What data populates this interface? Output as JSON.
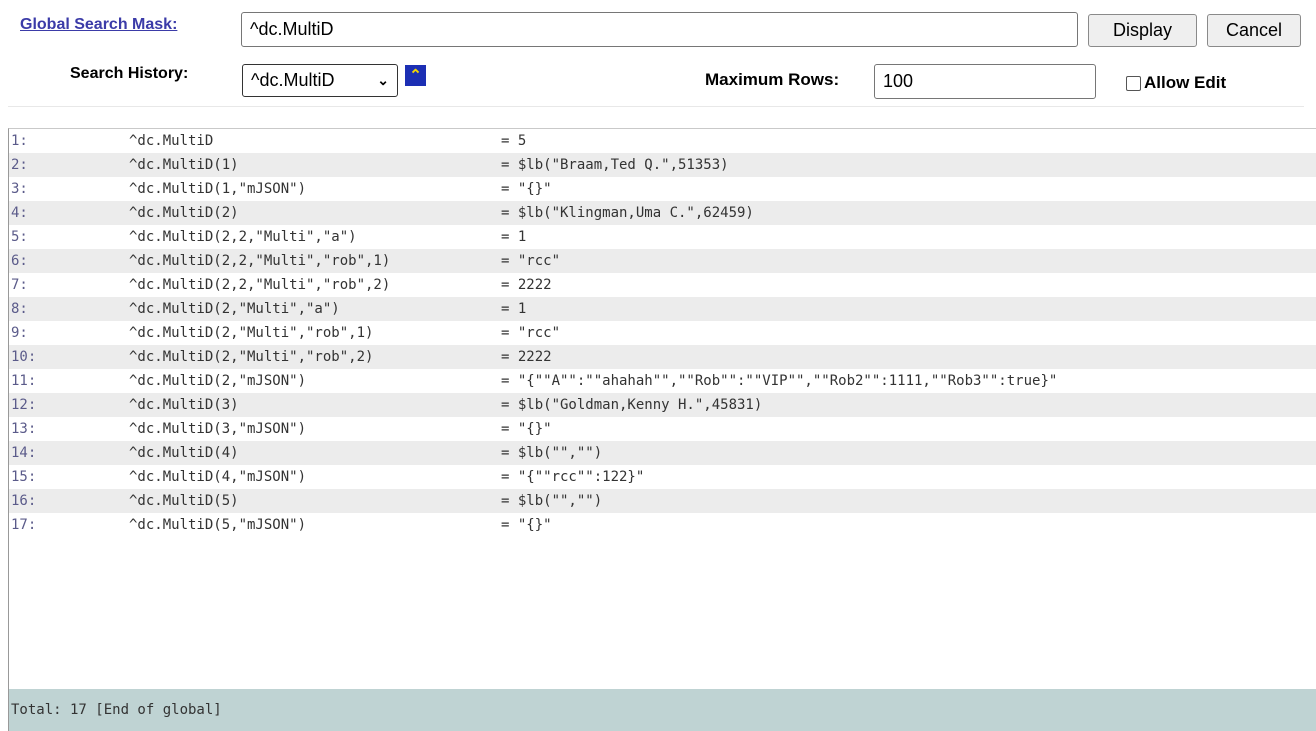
{
  "search": {
    "mask_label": "Global Search Mask:",
    "mask_value": "^dc.MultiD",
    "display_label": "Display",
    "cancel_label": "Cancel",
    "history_label": "Search History:",
    "history_selected": "^dc.MultiD",
    "max_rows_label": "Maximum Rows:",
    "max_rows_value": "100",
    "allow_edit_label": "Allow Edit",
    "allow_edit_checked": false
  },
  "results": {
    "rows": [
      {
        "num": "1:",
        "node": "^dc.MultiD",
        "value": "= 5"
      },
      {
        "num": "2:",
        "node": "^dc.MultiD(1)",
        "value": "= $lb(\"Braam,Ted Q.\",51353)"
      },
      {
        "num": "3:",
        "node": "^dc.MultiD(1,\"mJSON\")",
        "value": "= \"{}\""
      },
      {
        "num": "4:",
        "node": "^dc.MultiD(2)",
        "value": "= $lb(\"Klingman,Uma C.\",62459)"
      },
      {
        "num": "5:",
        "node": "^dc.MultiD(2,2,\"Multi\",\"a\")",
        "value": "= 1"
      },
      {
        "num": "6:",
        "node": "^dc.MultiD(2,2,\"Multi\",\"rob\",1)",
        "value": "= \"rcc\""
      },
      {
        "num": "7:",
        "node": "^dc.MultiD(2,2,\"Multi\",\"rob\",2)",
        "value": "= 2222"
      },
      {
        "num": "8:",
        "node": "^dc.MultiD(2,\"Multi\",\"a\")",
        "value": "= 1"
      },
      {
        "num": "9:",
        "node": "^dc.MultiD(2,\"Multi\",\"rob\",1)",
        "value": "= \"rcc\""
      },
      {
        "num": "10:",
        "node": "^dc.MultiD(2,\"Multi\",\"rob\",2)",
        "value": "= 2222"
      },
      {
        "num": "11:",
        "node": "^dc.MultiD(2,\"mJSON\")",
        "value": "= \"{\"\"A\"\":\"\"ahahah\"\",\"\"Rob\"\":\"\"VIP\"\",\"\"Rob2\"\":1111,\"\"Rob3\"\":true}\""
      },
      {
        "num": "12:",
        "node": "^dc.MultiD(3)",
        "value": "= $lb(\"Goldman,Kenny H.\",45831)"
      },
      {
        "num": "13:",
        "node": "^dc.MultiD(3,\"mJSON\")",
        "value": "= \"{}\""
      },
      {
        "num": "14:",
        "node": "^dc.MultiD(4)",
        "value": "= $lb(\"\",\"\")"
      },
      {
        "num": "15:",
        "node": "^dc.MultiD(4,\"mJSON\")",
        "value": "= \"{\"\"rcc\"\":122}\""
      },
      {
        "num": "16:",
        "node": "^dc.MultiD(5)",
        "value": "= $lb(\"\",\"\")"
      },
      {
        "num": "17:",
        "node": "^dc.MultiD(5,\"mJSON\")",
        "value": "= \"{}\""
      }
    ],
    "total_text": "Total: 17 [End of global]"
  }
}
